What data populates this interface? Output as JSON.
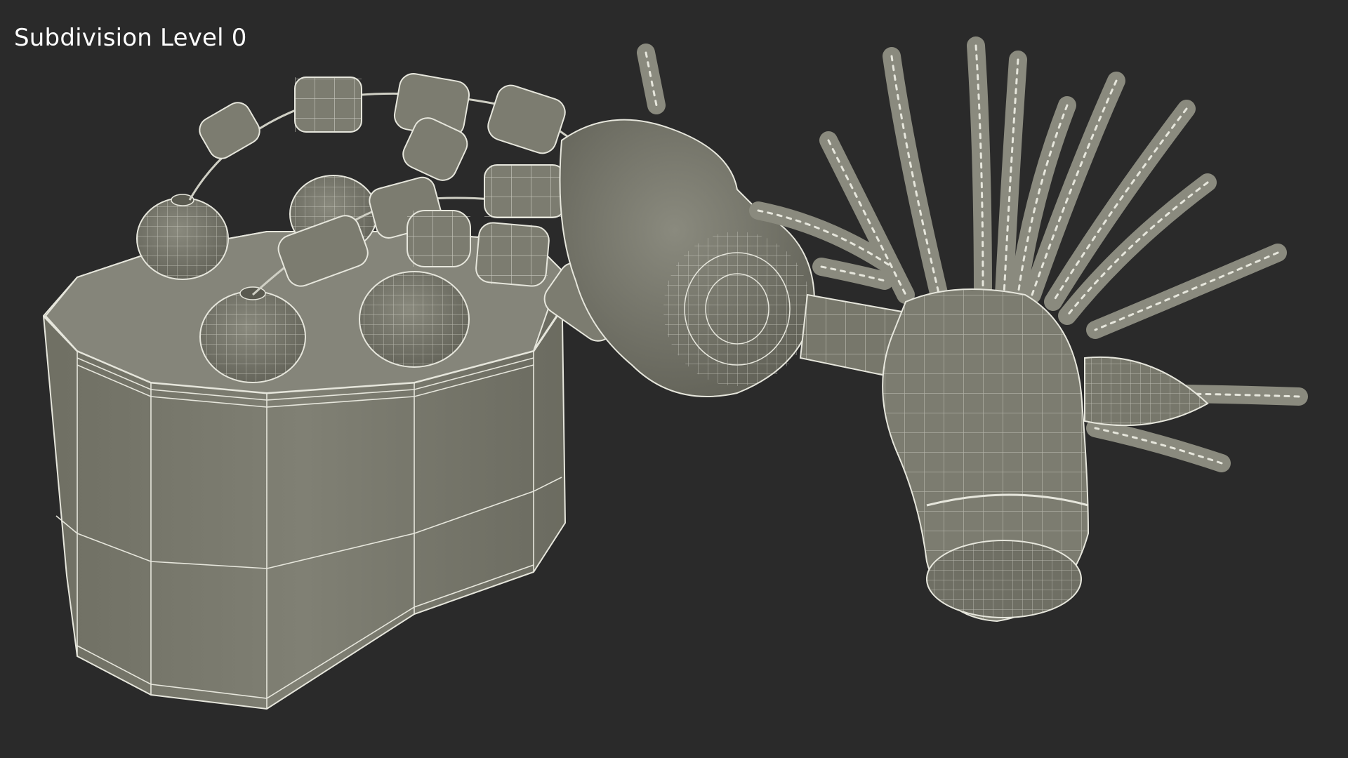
{
  "viewport": {
    "label": "Subdivision Level 0",
    "background_color": "#2a2a2a",
    "mesh_fill_color": "#7a7a6d",
    "mesh_wire_color": "#e6e6dc"
  }
}
